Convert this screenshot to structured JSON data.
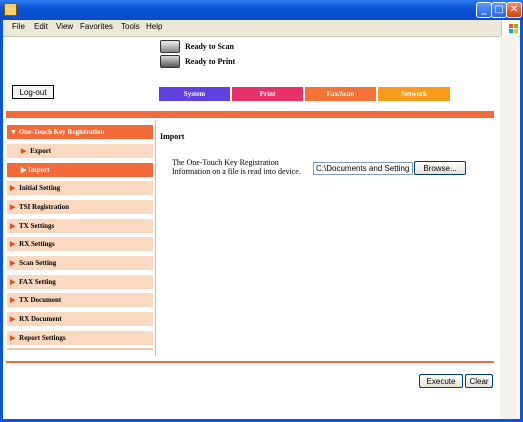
{
  "menubar": {
    "items": [
      "File",
      "Edit",
      "View",
      "Favorites",
      "Tools",
      "Help"
    ]
  },
  "status": {
    "scan": "Ready to Scan",
    "print": "Ready to Print"
  },
  "logout_label": "Log-out",
  "tabs": [
    {
      "label": "System",
      "color": "#6040e0"
    },
    {
      "label": "Print",
      "color": "#e8306a"
    },
    {
      "label": "Fax/Scan",
      "color": "#f47238"
    },
    {
      "label": "Network",
      "color": "#f89a1a"
    }
  ],
  "sidebar": {
    "items": [
      {
        "label": "One-Touch Key Registration",
        "prefix": "▼"
      },
      {
        "label": "Export",
        "prefix": "▶"
      },
      {
        "label": "Import",
        "prefix": "▶"
      },
      {
        "label": "Initial Setting",
        "prefix": "▶"
      },
      {
        "label": "TSI Registration",
        "prefix": "▶"
      },
      {
        "label": "TX Settings",
        "prefix": "▶"
      },
      {
        "label": "RX Settings",
        "prefix": "▶"
      },
      {
        "label": "Scan Setting",
        "prefix": "▶"
      },
      {
        "label": "FAX Setting",
        "prefix": "▶"
      },
      {
        "label": "TX Document",
        "prefix": "▶"
      },
      {
        "label": "RX Document",
        "prefix": "▶"
      },
      {
        "label": "Report Settings",
        "prefix": "▶"
      }
    ]
  },
  "main": {
    "heading": "Import",
    "description": "The One-Touch Key Registration Information on a file is read into device.",
    "file_value": "C:\\Documents and Setting",
    "browse_label": "Browse..."
  },
  "actions": {
    "execute_label": "Execute",
    "clear_label": "Clear"
  },
  "colors": {
    "accent": "#f26a3a",
    "sidebar_bg": "#fbd9c0",
    "sidebar_active": "#f26a3a",
    "titlebar": "#0b55d8"
  }
}
